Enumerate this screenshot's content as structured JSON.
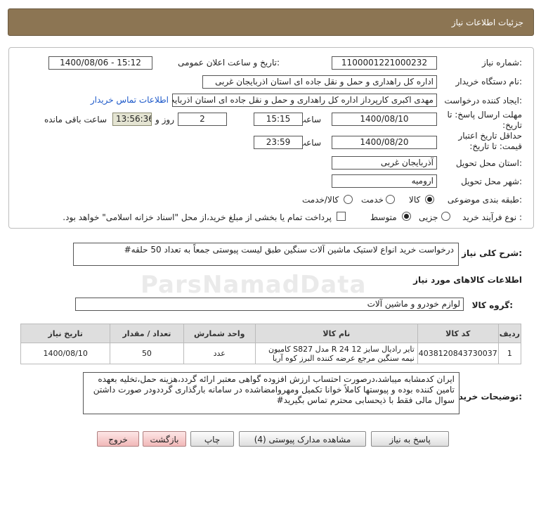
{
  "header": {
    "title": "جزئیات اطلاعات نیاز"
  },
  "fields": {
    "need_number_label": "شماره نیاز:",
    "need_number": "1100001221000232",
    "announce_label": "تاریخ و ساعت اعلان عمومی:",
    "announce_value": "1400/08/06 - 15:12",
    "buyer_label": "نام دستگاه خریدار:",
    "buyer_value": "اداره کل راهداری و حمل و نقل جاده ای استان اذربایجان غربی",
    "requester_label": "ایجاد کننده درخواست:",
    "requester_value": "مهدی اکبری کارپرداز اداره کل راهداری و حمل و نقل جاده ای استان اذربایجان غربی",
    "contact_link": "اطلاعات تماس خریدار",
    "deadline_label": "مهلت ارسال پاسخ: تا تاریخ:",
    "deadline_date": "1400/08/10",
    "time_label": "ساعت",
    "deadline_time": "15:15",
    "days_value": "2",
    "days_label": "روز و",
    "remaining_time": "13:56:36",
    "remaining_label": "ساعت باقی مانده",
    "validity_label": "حداقل تاریخ اعتبار قیمت: تا تاریخ:",
    "validity_date": "1400/08/20",
    "validity_time_label": "ساعت",
    "validity_time": "23:59",
    "province_label": "استان محل تحویل:",
    "province_value": "آذربایجان غربی",
    "city_label": "شهر محل تحویل:",
    "city_value": "ارومیه",
    "category_label": "طبقه بندی موضوعی:",
    "category_options": [
      "کالا",
      "خدمت",
      "کالا/خدمت"
    ],
    "process_label": "نوع فرآیند خرید :",
    "process_options": [
      "جزیی",
      "متوسط"
    ],
    "payment_note": "پرداخت تمام یا بخشی از مبلغ خرید،از محل \"اسناد خزانه اسلامی\" خواهد بود."
  },
  "summary": {
    "label": "شرح کلی نیاز:",
    "value": "درخواست خرید انواع لاستیک ماشین آلات سنگین طبق لیست پیوستی جمعاً به تعداد 50 حلقه#"
  },
  "goods_info_title": "اطلاعات کالاهای مورد نیاز",
  "goods_group": {
    "label": "گروه کالا:",
    "value": "لوازم خودرو و ماشین آلات"
  },
  "table": {
    "headers": [
      "ردیف",
      "کد کالا",
      "نام کالا",
      "واحد شمارش",
      "تعداد / مقدار",
      "تاریخ نیاز"
    ],
    "rows": [
      {
        "index": "1",
        "code": "4038120843730037",
        "name": "تایر رادیال سایز R 24 12 مدل S827 کامیون نیمه سنگین مرجع عرضه کننده البرز کوه آریا",
        "unit": "عدد",
        "qty": "50",
        "date": "1400/08/10"
      }
    ]
  },
  "buyer_notes": {
    "label": "توضیحات خریدار:",
    "value": "ایران کدمشابه میباشد،درصورت احتساب ارزش افزوده گواهی معتبر ارائه گردد،هزینه حمل،تخلیه بعهده تامین کننده بوده و پیوستها کاملاً خوانا تکمیل ومهروامضاشده در سامانه بارگذاری گرددودر صورت داشتن سوال مالی فقط با ذیحسابی محترم تماس بگیرید#"
  },
  "buttons": {
    "reply": "پاسخ به نیاز",
    "attachments": "مشاهده مدارک پیوستی (4)",
    "print": "چاپ",
    "back": "بازگشت",
    "exit": "خروج"
  },
  "watermark": "ParsNamadData",
  "colors": {
    "header_bg": "#8c7553",
    "link": "#1c58c9",
    "button_pink": "#f1b8b8"
  }
}
